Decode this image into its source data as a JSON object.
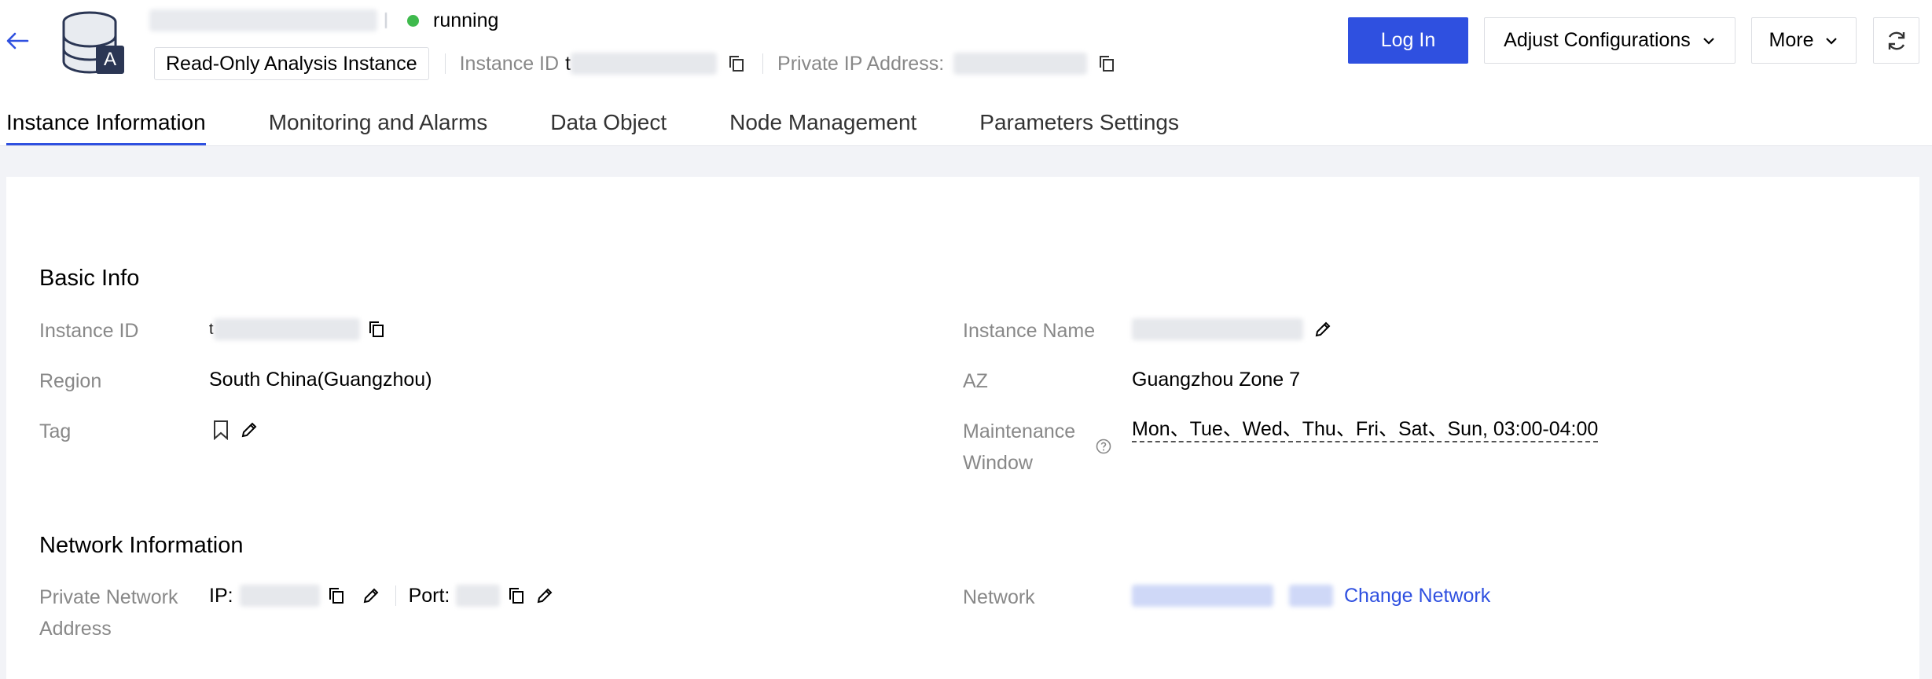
{
  "header": {
    "status": "running",
    "instance_type": "Read-Only Analysis Instance",
    "instance_id_label": "Instance ID",
    "instance_id_prefix": "t",
    "private_ip_label": "Private IP Address:",
    "login_label": "Log In",
    "adjust_label": "Adjust Configurations",
    "more_label": "More",
    "logo_letter": "A"
  },
  "tabs": [
    {
      "label": "Instance Information",
      "active": true
    },
    {
      "label": "Monitoring and Alarms",
      "active": false
    },
    {
      "label": "Data Object",
      "active": false
    },
    {
      "label": "Node Management",
      "active": false
    },
    {
      "label": "Parameters Settings",
      "active": false
    }
  ],
  "basic_info": {
    "title": "Basic Info",
    "instance_id_label": "Instance ID",
    "instance_id_prefix": "t",
    "region_label": "Region",
    "region_value": "South China(Guangzhou)",
    "tag_label": "Tag",
    "instance_name_label": "Instance Name",
    "az_label": "AZ",
    "az_value": "Guangzhou Zone 7",
    "maintenance_label_1": "Maintenance",
    "maintenance_label_2": "Window",
    "maintenance_value": "Mon、Tue、Wed、Thu、Fri、Sat、Sun, 03:00-04:00"
  },
  "network_info": {
    "title": "Network Information",
    "private_address_label_1": "Private Network",
    "private_address_label_2": "Address",
    "ip_label": "IP:",
    "port_label": "Port:",
    "network_label": "Network",
    "change_network_label": "Change Network"
  },
  "colors": {
    "accent": "#2f50e0",
    "status_running": "#3fba4d",
    "label_gray": "#888888",
    "page_bg": "#f2f3f7"
  },
  "icons": {
    "back": "arrow-left-icon",
    "logo": "database-icon",
    "copy": "copy-icon",
    "edit": "pencil-icon",
    "tag": "bookmark-icon",
    "help": "question-circle-icon",
    "dropdown": "chevron-down-icon",
    "refresh": "refresh-icon"
  }
}
